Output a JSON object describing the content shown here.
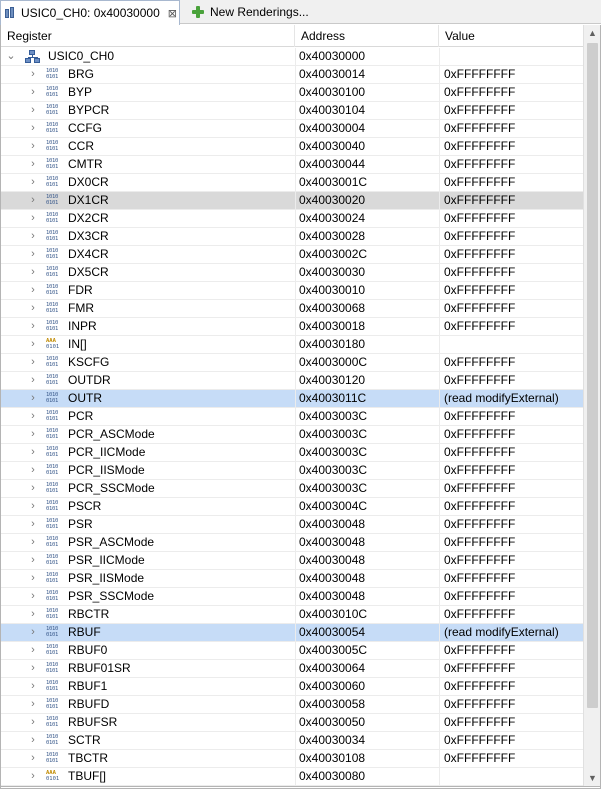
{
  "tabs": [
    {
      "title": "USIC0_CH0: 0x40030000",
      "close": "⊠",
      "icon": "memory-monitor-icon"
    },
    {
      "title": "New Renderings...",
      "icon": "plus-icon"
    }
  ],
  "columns": {
    "register": "Register",
    "address": "Address",
    "value": "Value"
  },
  "root": {
    "name": "USIC0_CH0",
    "address": "0x40030000",
    "value": ""
  },
  "rows": [
    {
      "name": "BRG",
      "address": "0x40030014",
      "value": "0xFFFFFFFF",
      "icon": "binary"
    },
    {
      "name": "BYP",
      "address": "0x40030100",
      "value": "0xFFFFFFFF",
      "icon": "binary"
    },
    {
      "name": "BYPCR",
      "address": "0x40030104",
      "value": "0xFFFFFFFF",
      "icon": "binary"
    },
    {
      "name": "CCFG",
      "address": "0x40030004",
      "value": "0xFFFFFFFF",
      "icon": "binary"
    },
    {
      "name": "CCR",
      "address": "0x40030040",
      "value": "0xFFFFFFFF",
      "icon": "binary"
    },
    {
      "name": "CMTR",
      "address": "0x40030044",
      "value": "0xFFFFFFFF",
      "icon": "binary"
    },
    {
      "name": "DX0CR",
      "address": "0x4003001C",
      "value": "0xFFFFFFFF",
      "icon": "binary"
    },
    {
      "name": "DX1CR",
      "address": "0x40030020",
      "value": "0xFFFFFFFF",
      "icon": "binary",
      "state": "gray"
    },
    {
      "name": "DX2CR",
      "address": "0x40030024",
      "value": "0xFFFFFFFF",
      "icon": "binary"
    },
    {
      "name": "DX3CR",
      "address": "0x40030028",
      "value": "0xFFFFFFFF",
      "icon": "binary"
    },
    {
      "name": "DX4CR",
      "address": "0x4003002C",
      "value": "0xFFFFFFFF",
      "icon": "binary"
    },
    {
      "name": "DX5CR",
      "address": "0x40030030",
      "value": "0xFFFFFFFF",
      "icon": "binary"
    },
    {
      "name": "FDR",
      "address": "0x40030010",
      "value": "0xFFFFFFFF",
      "icon": "binary"
    },
    {
      "name": "FMR",
      "address": "0x40030068",
      "value": "0xFFFFFFFF",
      "icon": "binary"
    },
    {
      "name": "INPR",
      "address": "0x40030018",
      "value": "0xFFFFFFFF",
      "icon": "binary"
    },
    {
      "name": "IN[]",
      "address": "0x40030180",
      "value": "",
      "icon": "array"
    },
    {
      "name": "KSCFG",
      "address": "0x4003000C",
      "value": "0xFFFFFFFF",
      "icon": "binary"
    },
    {
      "name": "OUTDR",
      "address": "0x40030120",
      "value": "0xFFFFFFFF",
      "icon": "binary"
    },
    {
      "name": "OUTR",
      "address": "0x4003011C",
      "value": "(read modifyExternal)",
      "icon": "binary",
      "state": "blue"
    },
    {
      "name": "PCR",
      "address": "0x4003003C",
      "value": "0xFFFFFFFF",
      "icon": "binary"
    },
    {
      "name": "PCR_ASCMode",
      "address": "0x4003003C",
      "value": "0xFFFFFFFF",
      "icon": "binary"
    },
    {
      "name": "PCR_IICMode",
      "address": "0x4003003C",
      "value": "0xFFFFFFFF",
      "icon": "binary"
    },
    {
      "name": "PCR_IISMode",
      "address": "0x4003003C",
      "value": "0xFFFFFFFF",
      "icon": "binary"
    },
    {
      "name": "PCR_SSCMode",
      "address": "0x4003003C",
      "value": "0xFFFFFFFF",
      "icon": "binary"
    },
    {
      "name": "PSCR",
      "address": "0x4003004C",
      "value": "0xFFFFFFFF",
      "icon": "binary"
    },
    {
      "name": "PSR",
      "address": "0x40030048",
      "value": "0xFFFFFFFF",
      "icon": "binary"
    },
    {
      "name": "PSR_ASCMode",
      "address": "0x40030048",
      "value": "0xFFFFFFFF",
      "icon": "binary"
    },
    {
      "name": "PSR_IICMode",
      "address": "0x40030048",
      "value": "0xFFFFFFFF",
      "icon": "binary"
    },
    {
      "name": "PSR_IISMode",
      "address": "0x40030048",
      "value": "0xFFFFFFFF",
      "icon": "binary"
    },
    {
      "name": "PSR_SSCMode",
      "address": "0x40030048",
      "value": "0xFFFFFFFF",
      "icon": "binary"
    },
    {
      "name": "RBCTR",
      "address": "0x4003010C",
      "value": "0xFFFFFFFF",
      "icon": "binary"
    },
    {
      "name": "RBUF",
      "address": "0x40030054",
      "value": "(read modifyExternal)",
      "icon": "binary",
      "state": "blue"
    },
    {
      "name": "RBUF0",
      "address": "0x4003005C",
      "value": "0xFFFFFFFF",
      "icon": "binary"
    },
    {
      "name": "RBUF01SR",
      "address": "0x40030064",
      "value": "0xFFFFFFFF",
      "icon": "binary"
    },
    {
      "name": "RBUF1",
      "address": "0x40030060",
      "value": "0xFFFFFFFF",
      "icon": "binary"
    },
    {
      "name": "RBUFD",
      "address": "0x40030058",
      "value": "0xFFFFFFFF",
      "icon": "binary"
    },
    {
      "name": "RBUFSR",
      "address": "0x40030050",
      "value": "0xFFFFFFFF",
      "icon": "binary"
    },
    {
      "name": "SCTR",
      "address": "0x40030034",
      "value": "0xFFFFFFFF",
      "icon": "binary"
    },
    {
      "name": "TBCTR",
      "address": "0x40030108",
      "value": "0xFFFFFFFF",
      "icon": "binary"
    },
    {
      "name": "TBUF[]",
      "address": "0x40030080",
      "value": "",
      "icon": "array"
    }
  ],
  "colors": {
    "selected_gray": "#d9d9d9",
    "selected_blue": "#c6dcf7",
    "icon_blue": "#3a5a8c"
  }
}
